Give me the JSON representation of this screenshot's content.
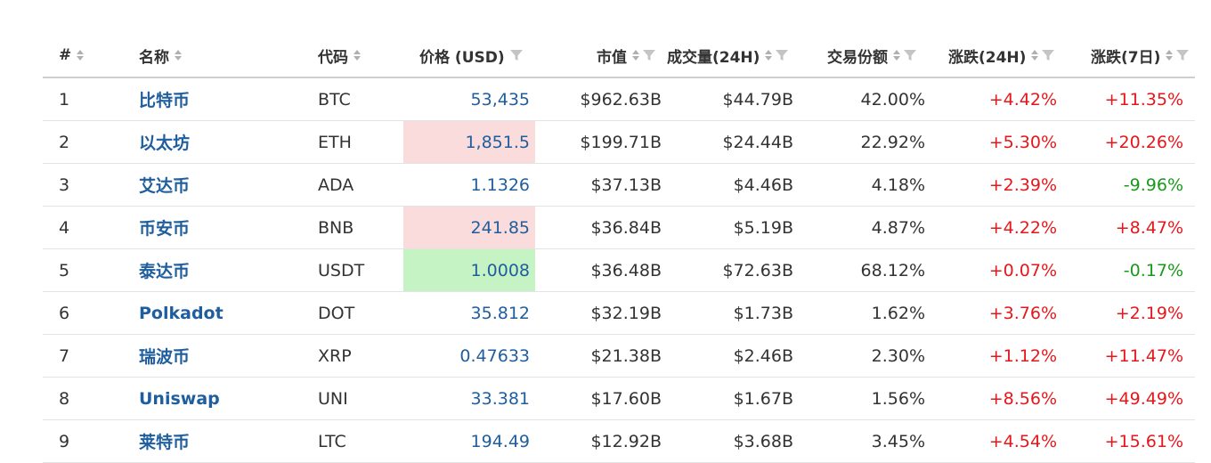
{
  "headers": {
    "rank": "#",
    "name": "名称",
    "code": "代码",
    "price": "价格 (USD)",
    "mcap": "市值",
    "volume": "成交量(24H)",
    "share": "交易份额",
    "chg24": "涨跌(24H)",
    "chg7": "涨跌(7日)"
  },
  "colors": {
    "link": "#1f5e9e",
    "up": "#e8161a",
    "down": "#1a9a1a",
    "flash_up": "#fbdcdc",
    "flash_down": "#c6f3c4"
  },
  "rows": [
    {
      "rank": "1",
      "name": "比特币",
      "code": "BTC",
      "price": "53,435",
      "mcap": "$962.63B",
      "volume": "$44.79B",
      "share": "42.00%",
      "chg24": "+4.42%",
      "chg7": "+11.35%",
      "chg7_dir": "up",
      "flash": "none"
    },
    {
      "rank": "2",
      "name": "以太坊",
      "code": "ETH",
      "price": "1,851.5",
      "mcap": "$199.71B",
      "volume": "$24.44B",
      "share": "22.92%",
      "chg24": "+5.30%",
      "chg7": "+20.26%",
      "chg7_dir": "up",
      "flash": "red"
    },
    {
      "rank": "3",
      "name": "艾达币",
      "code": "ADA",
      "price": "1.1326",
      "mcap": "$37.13B",
      "volume": "$4.46B",
      "share": "4.18%",
      "chg24": "+2.39%",
      "chg7": "-9.96%",
      "chg7_dir": "down",
      "flash": "none"
    },
    {
      "rank": "4",
      "name": "币安币",
      "code": "BNB",
      "price": "241.85",
      "mcap": "$36.84B",
      "volume": "$5.19B",
      "share": "4.87%",
      "chg24": "+4.22%",
      "chg7": "+8.47%",
      "chg7_dir": "up",
      "flash": "red"
    },
    {
      "rank": "5",
      "name": "泰达币",
      "code": "USDT",
      "price": "1.0008",
      "mcap": "$36.48B",
      "volume": "$72.63B",
      "share": "68.12%",
      "chg24": "+0.07%",
      "chg7": "-0.17%",
      "chg7_dir": "down",
      "flash": "green"
    },
    {
      "rank": "6",
      "name": "Polkadot",
      "code": "DOT",
      "price": "35.812",
      "mcap": "$32.19B",
      "volume": "$1.73B",
      "share": "1.62%",
      "chg24": "+3.76%",
      "chg7": "+2.19%",
      "chg7_dir": "up",
      "flash": "none"
    },
    {
      "rank": "7",
      "name": "瑞波币",
      "code": "XRP",
      "price": "0.47633",
      "mcap": "$21.38B",
      "volume": "$2.46B",
      "share": "2.30%",
      "chg24": "+1.12%",
      "chg7": "+11.47%",
      "chg7_dir": "up",
      "flash": "none"
    },
    {
      "rank": "8",
      "name": "Uniswap",
      "code": "UNI",
      "price": "33.381",
      "mcap": "$17.60B",
      "volume": "$1.67B",
      "share": "1.56%",
      "chg24": "+8.56%",
      "chg7": "+49.49%",
      "chg7_dir": "up",
      "flash": "none"
    },
    {
      "rank": "9",
      "name": "莱特币",
      "code": "LTC",
      "price": "194.49",
      "mcap": "$12.92B",
      "volume": "$3.68B",
      "share": "3.45%",
      "chg24": "+4.54%",
      "chg7": "+15.61%",
      "chg7_dir": "up",
      "flash": "none"
    }
  ]
}
